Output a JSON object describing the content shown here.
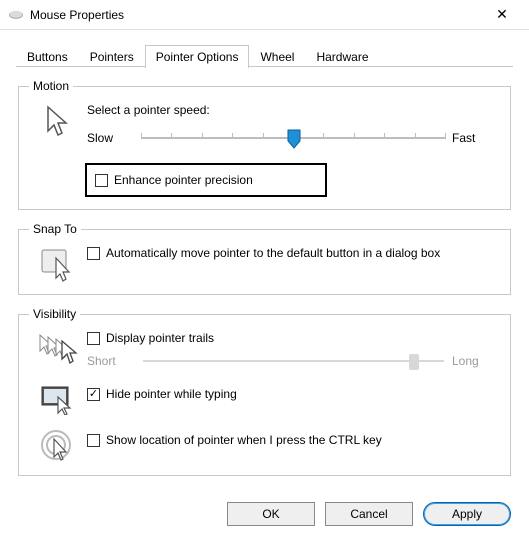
{
  "window": {
    "title": "Mouse Properties",
    "close_glyph": "✕"
  },
  "tabs": {
    "buttons": "Buttons",
    "pointers": "Pointers",
    "pointer_options": "Pointer Options",
    "wheel": "Wheel",
    "hardware": "Hardware",
    "active": "pointer_options"
  },
  "motion": {
    "legend": "Motion",
    "label": "Select a pointer speed:",
    "slow": "Slow",
    "fast": "Fast",
    "value_index": 5,
    "tick_count": 11,
    "enhance_label": "Enhance pointer precision",
    "enhance_checked": false
  },
  "snapto": {
    "legend": "Snap To",
    "label": "Automatically move pointer to the default button in a dialog box",
    "checked": false
  },
  "visibility": {
    "legend": "Visibility",
    "trails_label": "Display pointer trails",
    "trails_checked": false,
    "trails_short": "Short",
    "trails_long": "Long",
    "trails_value": 9,
    "trails_max": 10,
    "hide_label": "Hide pointer while typing",
    "hide_checked": true,
    "ctrl_label": "Show location of pointer when I press the CTRL key",
    "ctrl_checked": false
  },
  "buttons": {
    "ok": "OK",
    "cancel": "Cancel",
    "apply": "Apply"
  }
}
